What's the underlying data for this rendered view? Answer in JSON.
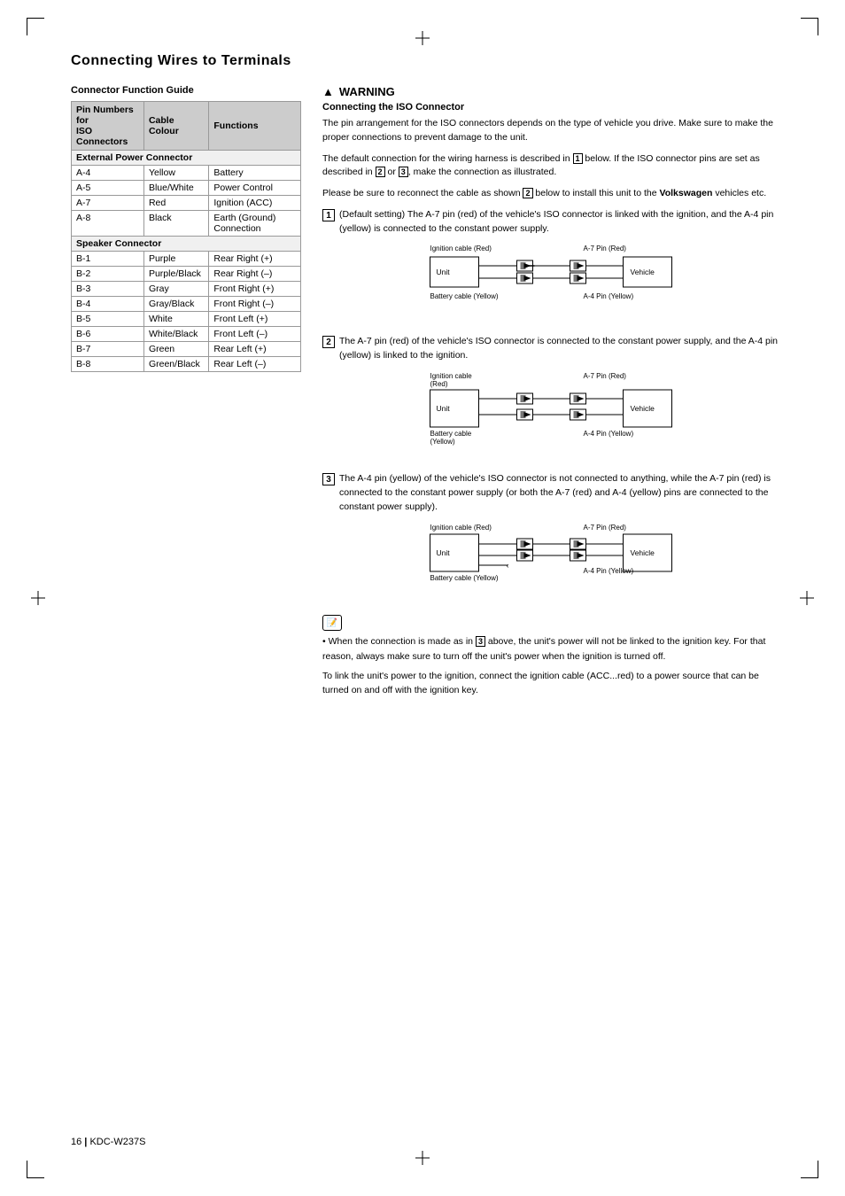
{
  "page": {
    "title": "Connecting Wires to Terminals",
    "footer": "16",
    "model": "KDC-W237S"
  },
  "left_section": {
    "heading": "Connector Function Guide",
    "table": {
      "headers": [
        "Pin Numbers for ISO Connectors",
        "Cable Colour",
        "Functions"
      ],
      "groups": [
        {
          "name": "External Power Connector",
          "rows": [
            {
              "pin": "A-4",
              "colour": "Yellow",
              "function": "Battery"
            },
            {
              "pin": "A-5",
              "colour": "Blue/White",
              "function": "Power Control"
            },
            {
              "pin": "A-7",
              "colour": "Red",
              "function": "Ignition (ACC)"
            },
            {
              "pin": "A-8",
              "colour": "Black",
              "function": "Earth (Ground) Connection"
            }
          ]
        },
        {
          "name": "Speaker Connector",
          "rows": [
            {
              "pin": "B-1",
              "colour": "Purple",
              "function": "Rear Right (+)"
            },
            {
              "pin": "B-2",
              "colour": "Purple/Black",
              "function": "Rear Right (–)"
            },
            {
              "pin": "B-3",
              "colour": "Gray",
              "function": "Front Right (+)"
            },
            {
              "pin": "B-4",
              "colour": "Gray/Black",
              "function": "Front Right (–)"
            },
            {
              "pin": "B-5",
              "colour": "White",
              "function": "Front Left (+)"
            },
            {
              "pin": "B-6",
              "colour": "White/Black",
              "function": "Front Left (–)"
            },
            {
              "pin": "B-7",
              "colour": "Green",
              "function": "Rear Left (+)"
            },
            {
              "pin": "B-8",
              "colour": "Green/Black",
              "function": "Rear Left (–)"
            }
          ]
        }
      ]
    }
  },
  "right_section": {
    "warning_label": "WARNING",
    "warning_icon": "▲",
    "heading": "Connecting the ISO Connector",
    "intro_paragraphs": [
      "The pin arrangement for the ISO connectors depends on the type of vehicle you drive. Make sure to make the proper connections to prevent damage to the unit.",
      "The default connection for the wiring harness is described in 1 below. If the ISO connector pins are set as described in 2 or 3, make the connection as illustrated.",
      "Please be sure to reconnect the cable as shown 2 below to install this unit to the Volkswagen vehicles etc."
    ],
    "items": [
      {
        "num": "1",
        "text": "(Default setting) The A-7 pin (red) of the vehicle's ISO connector is linked with the ignition, and the A-4 pin (yellow) is connected to the constant power supply.",
        "diagram": {
          "labels": {
            "ignition": "Ignition cable (Red)",
            "battery": "Battery cable (Yellow)",
            "a7": "A-7 Pin (Red)",
            "a4": "A-4 Pin (Yellow)",
            "unit": "Unit",
            "vehicle": "Vehicle"
          }
        }
      },
      {
        "num": "2",
        "text": "The A-7 pin (red) of the vehicle's ISO connector is connected to the constant power supply, and the A-4 pin (yellow) is linked to the ignition.",
        "diagram": {
          "labels": {
            "ignition": "Ignition cable (Red)",
            "battery": "Battery cable (Yellow)",
            "a7": "A-7 Pin (Red)",
            "a4": "A-4 Pin (Yellow)",
            "unit": "Unit",
            "vehicle": "Vehicle"
          }
        }
      },
      {
        "num": "3",
        "text": "The A-4 pin (yellow) of the vehicle's ISO connector is not connected to anything, while the A-7 pin (red) is connected to the constant power supply (or both the A-7 (red) and A-4 (yellow) pins are connected to the constant power supply).",
        "diagram": {
          "labels": {
            "ignition": "Ignition cable (Red)",
            "battery": "Battery cable (Yellow)",
            "a7": "A-7 Pin (Red)",
            "a4": "A-4 Pin (Yellow)",
            "unit": "Unit",
            "vehicle": "Vehicle"
          }
        }
      }
    ],
    "note": {
      "icon": "memo",
      "bullets": [
        "When the connection is made as in 3 above, the unit's power will not be linked to the ignition key. For that reason, always make sure to turn off the unit's power when the ignition is turned off.",
        "To link the unit's power to the ignition, connect the ignition cable (ACC...red) to a power source that can be turned on and off with the ignition key."
      ]
    }
  }
}
